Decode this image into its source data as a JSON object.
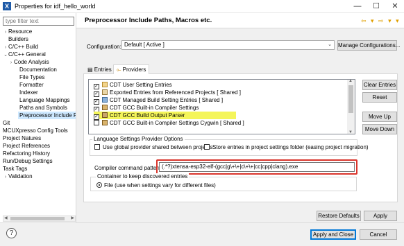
{
  "window": {
    "title": "Properties for idf_hello_world",
    "app_icon_glyph": "X",
    "minimize": "—",
    "maximize": "☐",
    "close": "✕"
  },
  "sidebar": {
    "filter_placeholder": "type filter text",
    "items": [
      {
        "label": "Resource",
        "twisty": "›"
      },
      {
        "label": "Builders",
        "twisty": ""
      },
      {
        "label": "C/C++ Build",
        "twisty": "›"
      },
      {
        "label": "C/C++ General",
        "twisty": "⌄"
      },
      {
        "label": "Code Analysis",
        "twisty": "›"
      },
      {
        "label": "Documentation",
        "twisty": ""
      },
      {
        "label": "File Types",
        "twisty": ""
      },
      {
        "label": "Formatter",
        "twisty": ""
      },
      {
        "label": "Indexer",
        "twisty": ""
      },
      {
        "label": "Language Mappings",
        "twisty": ""
      },
      {
        "label": "Paths and Symbols",
        "twisty": ""
      },
      {
        "label": "Preprocessor Include Pat",
        "twisty": ""
      },
      {
        "label": "Git",
        "twisty": ""
      },
      {
        "label": "MCUXpresso Config Tools",
        "twisty": ""
      },
      {
        "label": "Project Natures",
        "twisty": ""
      },
      {
        "label": "Project References",
        "twisty": ""
      },
      {
        "label": "Refactoring History",
        "twisty": ""
      },
      {
        "label": "Run/Debug Settings",
        "twisty": ""
      },
      {
        "label": "Task Tags",
        "twisty": ""
      },
      {
        "label": "Validation",
        "twisty": "›"
      }
    ]
  },
  "page": {
    "title": "Preprocessor Include Paths, Macros etc.",
    "nav_icons": "⇦ ▾ ⇨ ▾ ▾",
    "configuration_label": "Configuration:",
    "configuration_value": "Default  [ Active ]",
    "manage_button": "Manage Configurations...",
    "tabs": [
      {
        "label": "Entries",
        "icon": "▤"
      },
      {
        "label": "Providers",
        "icon": "⟜"
      }
    ]
  },
  "providers": {
    "rows": [
      {
        "checked": true,
        "label": "CDT User Setting Entries"
      },
      {
        "checked": true,
        "label": "Exported Entries from Referenced Projects   [ Shared ]"
      },
      {
        "checked": true,
        "label": "CDT Managed Build Setting Entries   [ Shared ]"
      },
      {
        "checked": true,
        "label": "CDT GCC Built-in Compiler Settings"
      },
      {
        "checked": true,
        "label": "CDT GCC Build Output Parser"
      },
      {
        "checked": false,
        "label": "CDT GCC Built-in Compiler Settings Cygwin   [ Shared ]"
      }
    ],
    "check_glyph": "✓",
    "buttons": {
      "clear": "Clear Entries",
      "reset": "Reset",
      "move_up": "Move Up",
      "move_down": "Move Down"
    }
  },
  "options": {
    "group_title": "Language Settings Provider Options",
    "use_global": "Use global provider shared between projects",
    "store_entries": "Store entries in project settings folder (easing project migration)",
    "compiler_pattern_label": "Compiler command pattern",
    "compiler_pattern_value": "(.*?)xtensa-esp32-elf-(gcc|g\\+\\+|c\\+\\+|cc|cpp|clang).exe",
    "container_title": "Container to keep discovered entries",
    "container_option": "File (use when settings vary for different files)"
  },
  "bottom": {
    "restore_defaults": "Restore Defaults",
    "apply": "Apply",
    "apply_and_close": "Apply and Close",
    "cancel": "Cancel",
    "help_glyph": "?"
  },
  "colors": {
    "highlight": "#f4f55a",
    "annotation_red": "#d9342b",
    "selection": "#cde8ff"
  }
}
